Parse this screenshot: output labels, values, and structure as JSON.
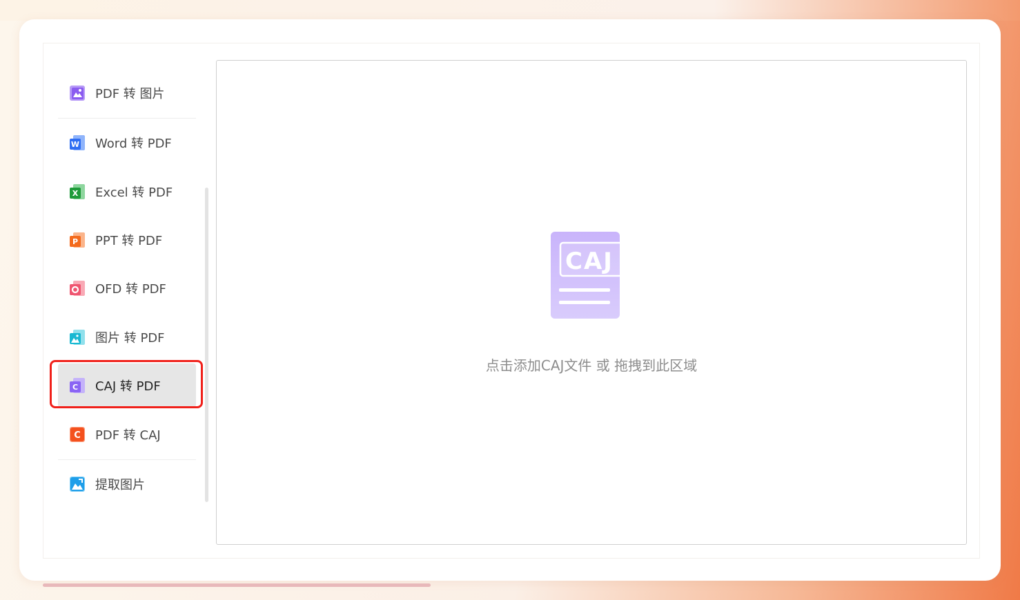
{
  "sidebar": {
    "items": [
      {
        "label": "PDF 转 图片",
        "icon": "pdf-to-image-icon",
        "color": "#9a6cf2",
        "active": false
      },
      {
        "label": "Word 转 PDF",
        "icon": "word-icon",
        "color": "#3d7cf5",
        "active": false
      },
      {
        "label": "Excel 转 PDF",
        "icon": "excel-icon",
        "color": "#2eaa47",
        "active": false
      },
      {
        "label": "PPT 转 PDF",
        "icon": "ppt-icon",
        "color": "#f77a2a",
        "active": false
      },
      {
        "label": "OFD 转 PDF",
        "icon": "ofd-icon",
        "color": "#f0647a",
        "active": false
      },
      {
        "label": "图片 转 PDF",
        "icon": "image-to-pdf-icon",
        "color": "#27c1d8",
        "active": false
      },
      {
        "label": "CAJ 转 PDF",
        "icon": "caj-icon",
        "color": "#8f6df5",
        "active": true
      },
      {
        "label": "PDF 转 CAJ",
        "icon": "pdf-to-caj-icon",
        "color": "#f5582a",
        "active": false
      },
      {
        "label": "提取图片",
        "icon": "extract-image-icon",
        "color": "#23a6ee",
        "active": false
      }
    ]
  },
  "dropzone": {
    "illustration_text": "CAJ",
    "hint": "点击添加CAJ文件 或 拖拽到此区域"
  },
  "colors": {
    "accent_highlight": "#f0201a",
    "caj_illustration": "#c7b0fb"
  }
}
